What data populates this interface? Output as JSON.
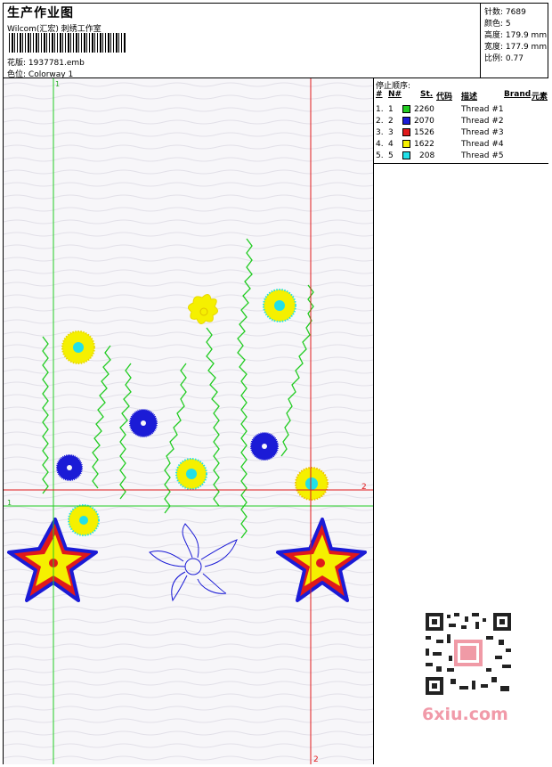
{
  "header": {
    "title": "生产作业图",
    "studio": "Wilcom(汇宏) 刺绣工作室",
    "design_label": "花版:",
    "design_file": "1937781.emb",
    "colorway_label": "色位:",
    "colorway": "Colorway 1"
  },
  "stats": [
    {
      "label": "针数:",
      "value": "7689"
    },
    {
      "label": "颜色:",
      "value": "5"
    },
    {
      "label": "高度:",
      "value": "179.9 mm"
    },
    {
      "label": "宽度:",
      "value": "177.9 mm"
    },
    {
      "label": "比例:",
      "value": "0.77"
    }
  ],
  "thread_panel": {
    "heading": "停止顺序:",
    "columns": [
      "#",
      "N#",
      "St.",
      "代码",
      "描述",
      "Brand",
      "元素"
    ],
    "rows": [
      {
        "num": "1.",
        "n": "1",
        "color": "#22cc22",
        "code": "2260",
        "desc": "Thread #1"
      },
      {
        "num": "2.",
        "n": "2",
        "color": "#1b1bd6",
        "code": "2070",
        "desc": "Thread #2"
      },
      {
        "num": "3.",
        "n": "3",
        "color": "#e0191b",
        "code": "1526",
        "desc": "Thread #3"
      },
      {
        "num": "4.",
        "n": "4",
        "color": "#f5f000",
        "code": "1622",
        "desc": "Thread #4"
      },
      {
        "num": "5.",
        "n": "5",
        "color": "#22e0e8",
        "code": "208",
        "desc": "Thread #5"
      }
    ]
  },
  "guides": {
    "green_v": "1",
    "green_h": "1",
    "red_h": "2",
    "red_v": "2"
  },
  "watermark": {
    "text": "6xiu.com"
  },
  "colors": {
    "green": "#22cc22",
    "red": "#e0191b",
    "blue": "#1b1bd6",
    "yellow": "#f5f000",
    "cyan": "#22e0e8"
  }
}
